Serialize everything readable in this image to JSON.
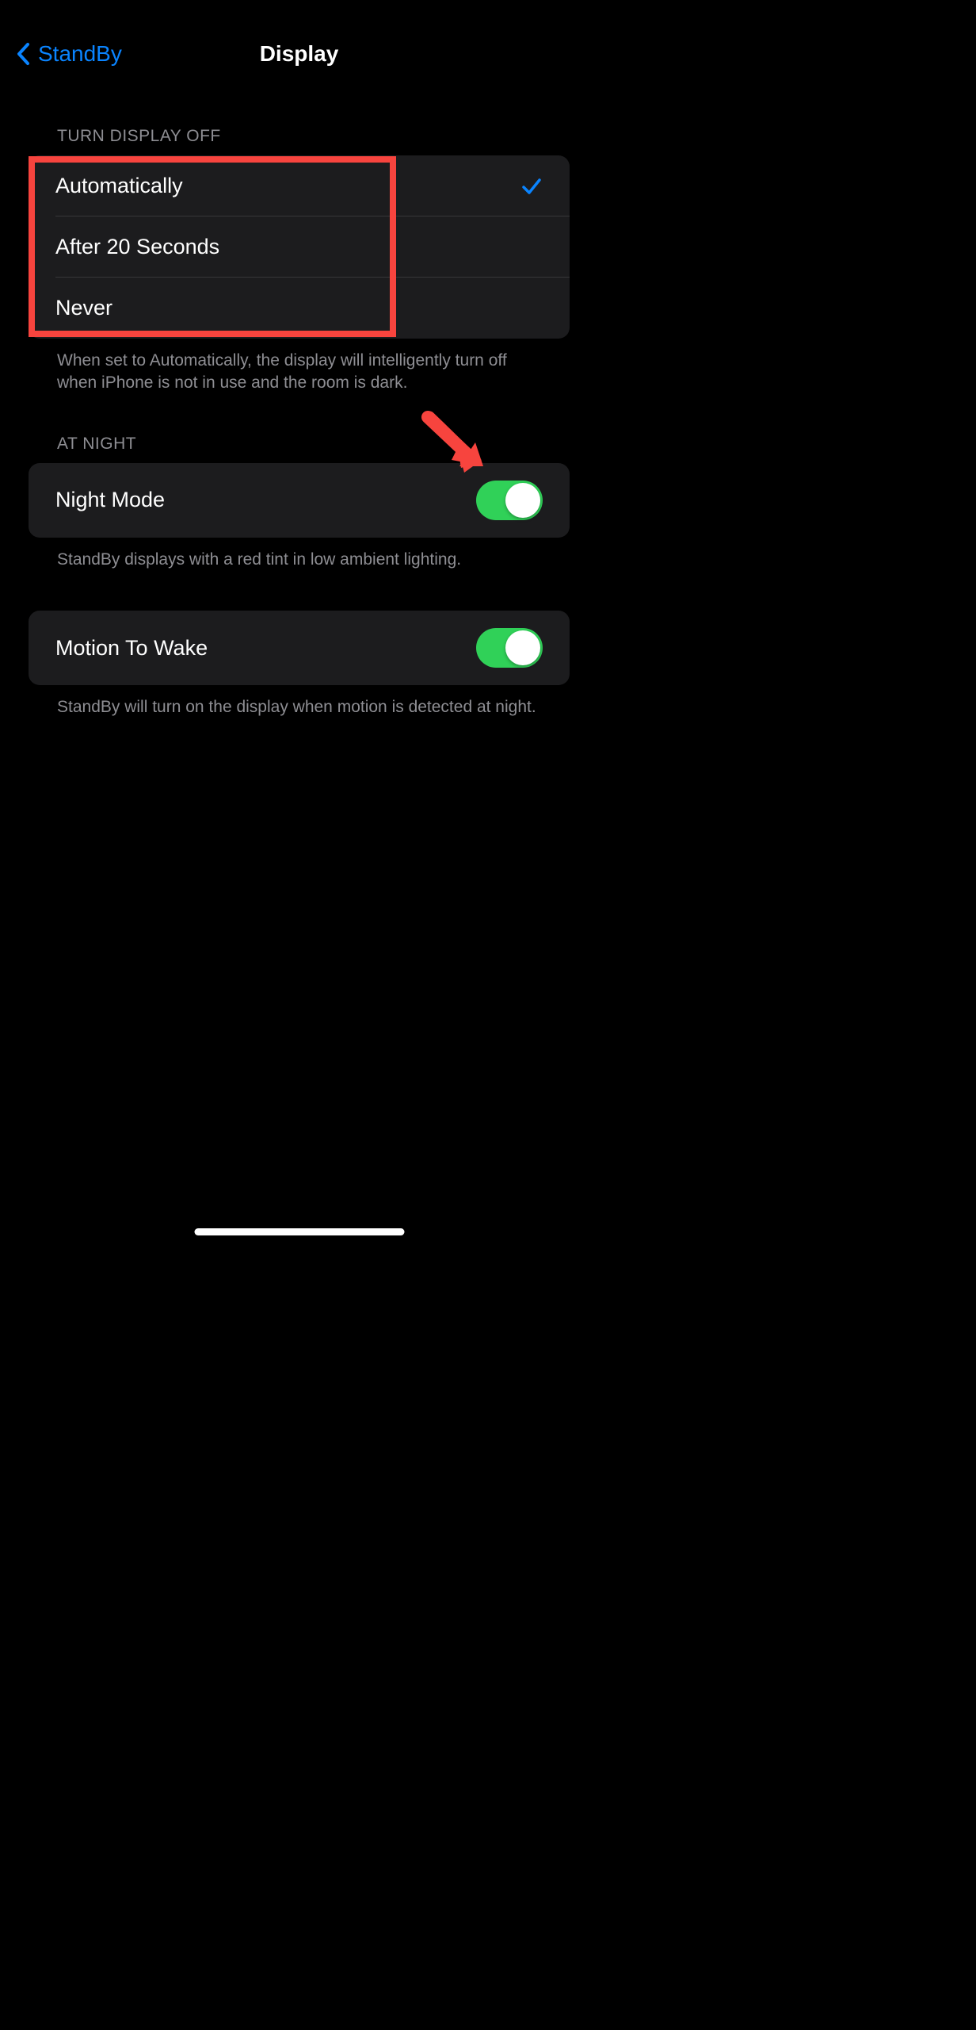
{
  "nav": {
    "back_label": "StandBy",
    "title": "Display"
  },
  "sections": {
    "turn_display_off": {
      "header": "TURN DISPLAY OFF",
      "options": [
        {
          "label": "Automatically",
          "selected": true
        },
        {
          "label": "After 20 Seconds",
          "selected": false
        },
        {
          "label": "Never",
          "selected": false
        }
      ],
      "footer": "When set to Automatically, the display will intelligently turn off when iPhone is not in use and the room is dark."
    },
    "at_night": {
      "header": "AT NIGHT",
      "night_mode": {
        "label": "Night Mode",
        "enabled": true
      },
      "footer": "StandBy displays with a red tint in low ambient lighting."
    },
    "motion_to_wake": {
      "label": "Motion To Wake",
      "enabled": true,
      "footer": "StandBy will turn on the display when motion is detected at night."
    }
  },
  "annotations": {
    "highlight_color": "#f7443e",
    "arrow_color": "#f7443e"
  }
}
